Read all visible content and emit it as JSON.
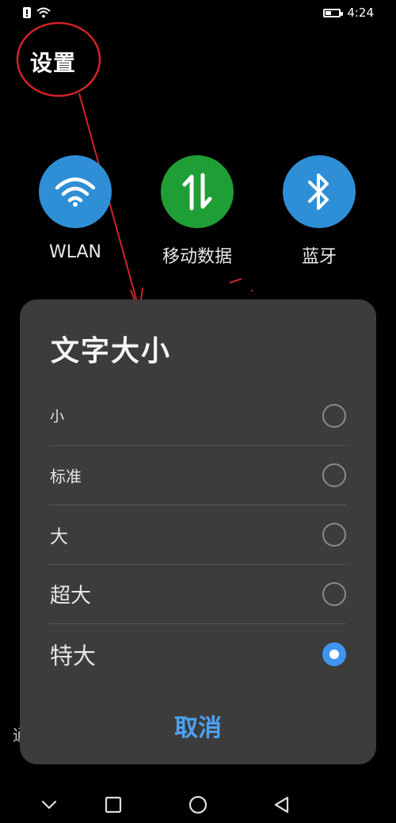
{
  "status_bar": {
    "time": "4:24",
    "icons": [
      "alert-sim-icon",
      "wifi-icon",
      "battery-icon"
    ],
    "battery_level": 0.4
  },
  "page_title": "设置",
  "quick_tiles": [
    {
      "label": "WLAN",
      "icon": "wifi-icon",
      "color": "#2f8fd6"
    },
    {
      "label": "移动数据",
      "icon": "mobile-data-icon",
      "color": "#1f9e35"
    },
    {
      "label": "蓝牙",
      "icon": "bluetooth-icon",
      "color": "#2f8fd6"
    }
  ],
  "dialog": {
    "title": "文字大小",
    "options": [
      {
        "label": "小",
        "checked": false
      },
      {
        "label": "标准",
        "checked": false
      },
      {
        "label": "大",
        "checked": false
      },
      {
        "label": "超大",
        "checked": false
      },
      {
        "label": "特大",
        "checked": true
      }
    ],
    "cancel_label": "取消",
    "accent_color": "#3d95f0"
  },
  "background_fragment": "通",
  "nav_bar": {
    "icons": [
      "chevron-down-icon",
      "recents-icon",
      "home-icon",
      "back-icon"
    ]
  },
  "annotation_color": "#d0232a"
}
